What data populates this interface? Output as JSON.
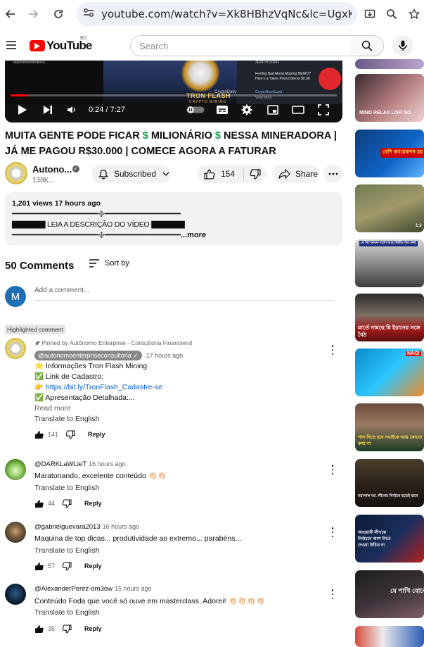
{
  "browser": {
    "url": "youtube.com/watch?v=Xk8HBhzVqNc&lc=UgxK1cUTpo..."
  },
  "header": {
    "logo_text": "YouTube",
    "country_code": "BD",
    "search_placeholder": "Search"
  },
  "player": {
    "time_current": "0:24",
    "time_total": "7:27",
    "progress": 0.054,
    "thumb_brand": "TRON FLASH",
    "thumb_brand_sub": "CRYPTO MINING",
    "crypto_daily": "CryptoDaily",
    "zenith": "ZENITH ZORO",
    "news_text": "Feeling Bad About Missing NEIRO? Here's a Token Priced Below $0.08",
    "news_source": "CryptoNewsLand",
    "view_more": "View More",
    "channel_overlay": "autonomoenterprise..."
  },
  "video": {
    "title_part1": "MUITA GENTE PODE FICAR ",
    "title_dollar": "$",
    "title_part2": " MILIONÁRIO ",
    "title_part3": "  NESSA MINERADORA | JÁ ME PAGOU R$30.000 | COMECE AGORA A FATURAR"
  },
  "channel": {
    "name": "Autono...",
    "subscribers": "138K...",
    "subscribed_label": "Subscribed",
    "likes": "154",
    "share_label": "Share"
  },
  "description": {
    "meta": "1,201 views  17 hours ago",
    "line1": "━━━━━━━━━━━━━━━━━━━━࿇━━━━━━━━━━━━━━━━━━━━",
    "line2": "▇▇▇▇▇▇ LEIA A DESCRIÇÃO DO VÍDEO ▇▇▇▇▇▇",
    "line3": "━━━━━━━━━━━━━━━━━━━━࿇━━━━━━━━━━━━━━━━━━━━",
    "more_label": "...more"
  },
  "comments": {
    "count_label": "50 Comments",
    "sort_label": "Sort by",
    "add_placeholder": "Add a comment...",
    "user_initial": "M",
    "highlighted_label": "Highlighted comment",
    "items": [
      {
        "pinned": "Pinned by Autônomo Enterprise - Consultoria Financeira!",
        "handle": "@autonomoenterpriseconsultoria",
        "time": "17 hours ago",
        "lines": [
          "⭐ Informações Tron Flash Mining",
          "✅ Link de Cadastro:",
          "👉 ",
          "✅ Apresentação Detalhada:..."
        ],
        "link": "https://bit.ly/TronFlash_Cadastre-se",
        "read_more": "Read more",
        "translate": "Translate to English",
        "likes": "141",
        "reply": "Reply"
      },
      {
        "handle": "@DARKLaWLieT",
        "time": "16 hours ago",
        "text": "Maratonando, excelente conteúdo 👏🏻👏🏻",
        "translate": "Translate to English",
        "likes": "44",
        "reply": "Reply"
      },
      {
        "handle": "@gabrielguevara2013",
        "time": "16 hours ago",
        "text": "Maquina de top dicas... produtividade ao extremo... parabéns...",
        "translate": "Translate to English",
        "likes": "57",
        "reply": "Reply"
      },
      {
        "handle": "@AlexanderPerez-om3ow",
        "time": "15 hours ago",
        "text": "Conteúdo Foda que você só ouve em masterclass. Adorei! 👏🏻👏🏻👏🏻👏🏻",
        "translate": "Translate to English",
        "likes": "35",
        "reply": "Reply"
      }
    ]
  },
  "sidebar": {
    "captions": [
      "MIND RELAX LOFI SO",
      "বেশি ক্যারেকশন হয় গেছে",
      "",
      "যে বিস্ফোরক বলো আর দ্বিতীয় বার কথা",
      "মার্তে নামছে মি ইরানের সঙ্গে বৈঠ",
      "NÃO!",
      "পাস দিতে হবে সবাইকে আর কোনো কথা না",
      "নয়াপাল আ. লীগের নির্বাচন হতেই যাবে",
      "আওয়ামী লীগকে নির্বাচনে অংশ নিতে দেওয়া উচিত না",
      "যে পাখি বোঝে",
      "1:2"
    ]
  }
}
